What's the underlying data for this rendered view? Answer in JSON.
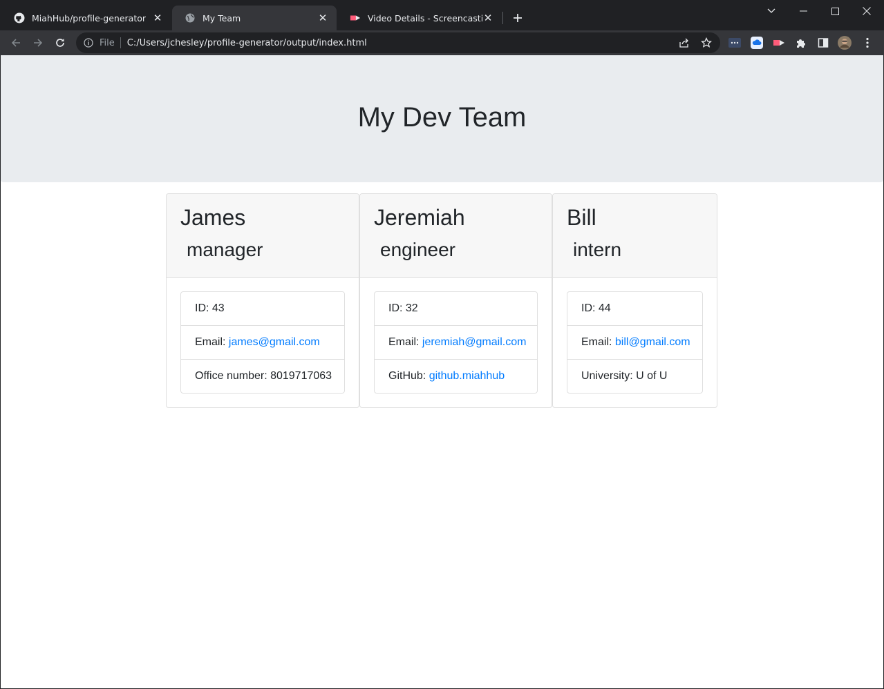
{
  "browser": {
    "tabs": [
      {
        "title": "MiahHub/profile-generator",
        "icon": "github-icon"
      },
      {
        "title": "My Team",
        "icon": "globe-icon"
      },
      {
        "title": "Video Details - Screencastify",
        "icon": "screencastify-icon"
      }
    ],
    "address": {
      "scheme": "File",
      "url": "C:/Users/jchesley/profile-generator/output/index.html"
    },
    "extensions": [
      "extensions-menu-icon",
      "cloud-icon",
      "screencastify-icon",
      "puzzle-icon",
      "side-panel-icon",
      "profile-avatar",
      "kebab-menu-icon"
    ]
  },
  "page": {
    "heading": "My Dev Team",
    "members": [
      {
        "name": "James",
        "role": "manager",
        "id_label": "ID: 43",
        "email_label": "Email: ",
        "email": "james@gmail.com",
        "extra_label": "Office number: 8019717063"
      },
      {
        "name": "Jeremiah",
        "role": "engineer",
        "id_label": "ID: 32",
        "email_label": "Email: ",
        "email": "jeremiah@gmail.com",
        "extra_label": "GitHub: ",
        "extra_link": "github.miahhub"
      },
      {
        "name": "Bill",
        "role": "intern",
        "id_label": "ID: 44",
        "email_label": "Email: ",
        "email": "bill@gmail.com",
        "extra_label": "University: U of U"
      }
    ]
  },
  "colors": {
    "jumbotron": "#e9ecef",
    "link": "#007bff",
    "chrome_dark": "#202124",
    "chrome_toolbar": "#35363a"
  }
}
